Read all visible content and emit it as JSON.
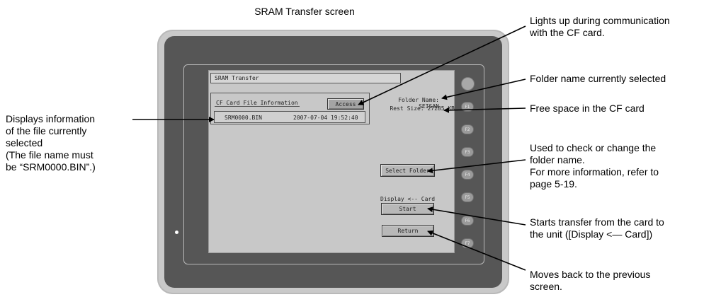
{
  "figure_title": "SRAM Transfer screen",
  "screen": {
    "title": "SRAM Transfer",
    "cf_card_info_label": "CF Card File Information",
    "access_button": "Access",
    "file_name": "SRM0000.BIN",
    "file_datetime": "2007-07-04 19:52:40",
    "folder_name_line": "Folder Name:  SEISAN",
    "rest_size_line": "Rest Size:  27285 KB",
    "select_folder_button": "Select Folder",
    "direction_label": "Display <-- Card",
    "start_button": "Start",
    "return_button": "Return"
  },
  "function_keys": [
    "F1",
    "F2",
    "F3",
    "F4",
    "F5",
    "F6",
    "F7"
  ],
  "annotations": {
    "file_info": "Displays information\nof the file currently\nselected\n(The file name must\nbe “SRM0000.BIN”.)",
    "access_lamp": "Lights up during communication\nwith the CF card.",
    "folder_name": "Folder name currently selected",
    "free_space": "Free space in the CF card",
    "select_folder": "Used to check or change the\nfolder name.\nFor more information, refer to\npage 5-19.",
    "start": "Starts transfer from the card to\nthe unit ([Display <— Card])",
    "return": "Moves back to the previous\nscreen."
  }
}
